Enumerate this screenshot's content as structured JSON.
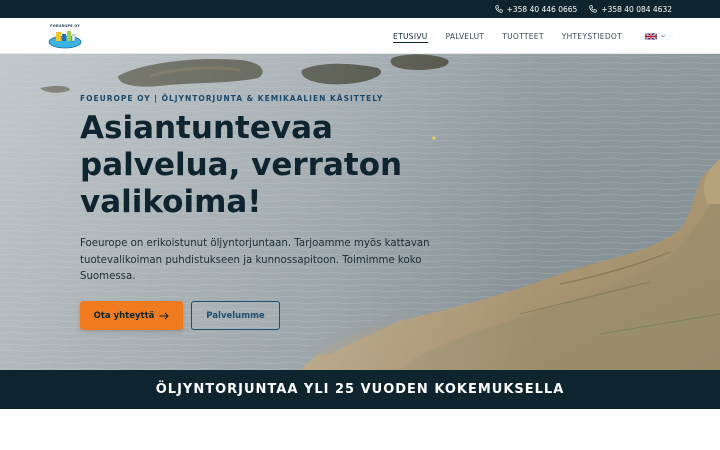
{
  "topbar": {
    "phones": [
      "+358 40 446 0665",
      "+358 40 084 4632"
    ]
  },
  "header": {
    "logo_text": "FOEUROPE OY",
    "nav": [
      {
        "label": "ETUSIVU",
        "active": true
      },
      {
        "label": "PALVELUT",
        "active": false
      },
      {
        "label": "TUOTTEET",
        "active": false
      },
      {
        "label": "YHTEYSTIEDOT",
        "active": false
      }
    ],
    "language_icon": "uk-flag-icon"
  },
  "hero": {
    "eyebrow": "FOEUROPE OY | ÖLJYNTORJUNTA & KEMIKAALIEN KÄSITTELY",
    "headline_lines": [
      "Asiantuntevaa",
      "palvelua, verraton",
      "valikoima!"
    ],
    "lead": "Foeurope on erikoistunut öljyntorjuntaan. Tarjoamme myös kattavan tuotevalikoiman puhdistukseen ja kunnossapitoon. Toimimme koko Suomessa.",
    "primary_button": "Ota yhteyttä",
    "primary_button_icon": "arrow-right-icon",
    "secondary_button": "Palvelumme"
  },
  "banner": {
    "text": "ÖLJYNTORJUNTAA YLI 25 VUODEN KOKEMUKSELLA"
  },
  "colors": {
    "dark": "#0e2530",
    "accent": "#f07b1f",
    "outline": "#1f4e6e"
  }
}
